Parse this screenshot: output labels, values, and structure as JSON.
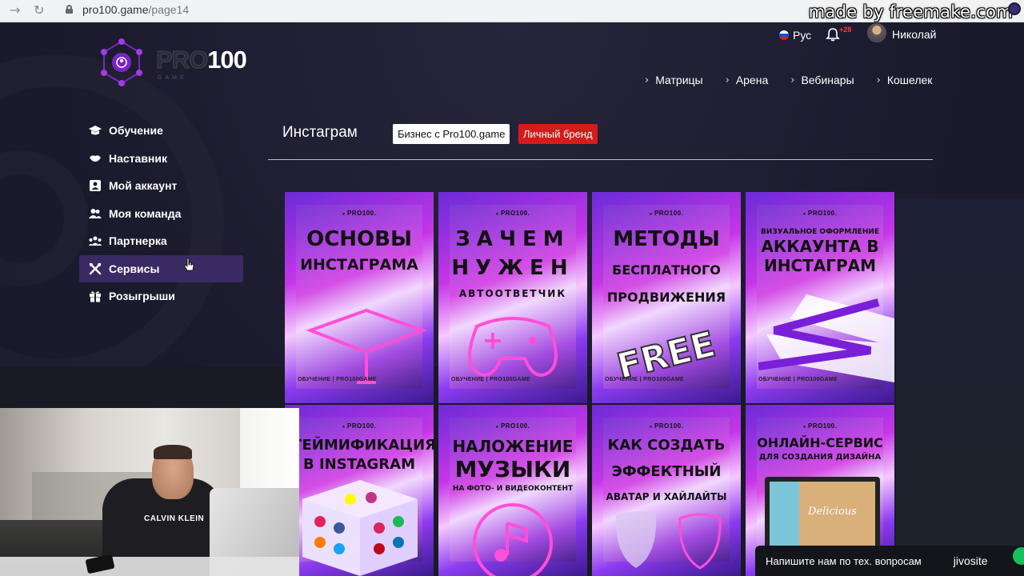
{
  "browser": {
    "url_host": "pro100.game",
    "url_path": "/page14"
  },
  "watermark": "made by freemake.com",
  "logo": {
    "pro": "PRO",
    "num": "100",
    "sub": "GAME"
  },
  "header": {
    "language": "Рус",
    "notifications_badge": "+28",
    "username": "Николай"
  },
  "top_nav": [
    {
      "label": "Матрицы"
    },
    {
      "label": "Арена"
    },
    {
      "label": "Вебинары"
    },
    {
      "label": "Кошелек"
    }
  ],
  "sidebar": {
    "items": [
      {
        "label": "Обучение",
        "icon": "graduation-cap-icon"
      },
      {
        "label": "Наставник",
        "icon": "handshake-icon"
      },
      {
        "label": "Мой аккаунт",
        "icon": "user-card-icon"
      },
      {
        "label": "Моя команда",
        "icon": "team-icon"
      },
      {
        "label": "Партнерка",
        "icon": "partners-icon"
      },
      {
        "label": "Сервисы",
        "icon": "tools-icon",
        "active": true
      },
      {
        "label": "Розыгрыши",
        "icon": "gift-icon"
      }
    ]
  },
  "content": {
    "section_title": "Инстаграм",
    "chips": [
      {
        "label": "Бизнес с Pro100.game",
        "style": "white"
      },
      {
        "label": "Личный бренд",
        "style": "red"
      }
    ]
  },
  "cards": [
    {
      "brand": "PRO100.",
      "lines": [
        "ОСНОВЫ",
        "ИНСТАГРАМА"
      ],
      "footer": "ОБУЧЕНИЕ  |  PRO100GAME"
    },
    {
      "brand": "PRO100.",
      "lines": [
        "ЗАЧЕМ",
        "НУЖЕН",
        "АВТООТВЕТЧИК"
      ],
      "footer": "ОБУЧЕНИЕ  |  PRO100GAME"
    },
    {
      "brand": "PRO100.",
      "lines": [
        "МЕТОДЫ",
        "БЕСПЛАТНОГО",
        "ПРОДВИЖЕНИЯ"
      ],
      "stamp": "FREE",
      "footer": "ОБУЧЕНИЕ  |  PRO100GAME"
    },
    {
      "brand": "PRO100.",
      "lines": [
        "ВИЗУАЛЬНОЕ ОФОРМЛЕНИЕ",
        "АККАУНТА В",
        "ИНСТАГРАМ"
      ],
      "footer": "ОБУЧЕНИЕ  |  PRO100GAME"
    },
    {
      "brand": "PRO100.",
      "lines": [
        "ГЕЙМИФИКАЦИЯ",
        "В INSTAGRAM"
      ]
    },
    {
      "brand": "PRO100.",
      "lines": [
        "НАЛОЖЕНИЕ",
        "МУЗЫКИ",
        "НА ФОТО- И ВИДЕОКОНТЕНТ"
      ]
    },
    {
      "brand": "PRO100.",
      "lines": [
        "КАК СОЗДАТЬ",
        "ЭФФЕКТНЫЙ",
        "АВАТАР И ХАЙЛАЙТЫ"
      ]
    },
    {
      "brand": "PRO100.",
      "lines": [
        "ОНЛАЙН-СЕРВИС",
        "ДЛЯ СОЗДАНИЯ ДИЗАЙНА"
      ],
      "screen_text": "Delicious"
    }
  ],
  "webcam": {
    "shirt_text": "CALVIN KLEIN"
  },
  "chat": {
    "text": "Напишите нам по тех. вопросам",
    "brand": "jivosite"
  },
  "colors": {
    "active_sidebar": "#3a2a64",
    "chip_red": "#d61b1b",
    "chat_bubble": "#17c15b",
    "card_purple": "#c535e8"
  }
}
